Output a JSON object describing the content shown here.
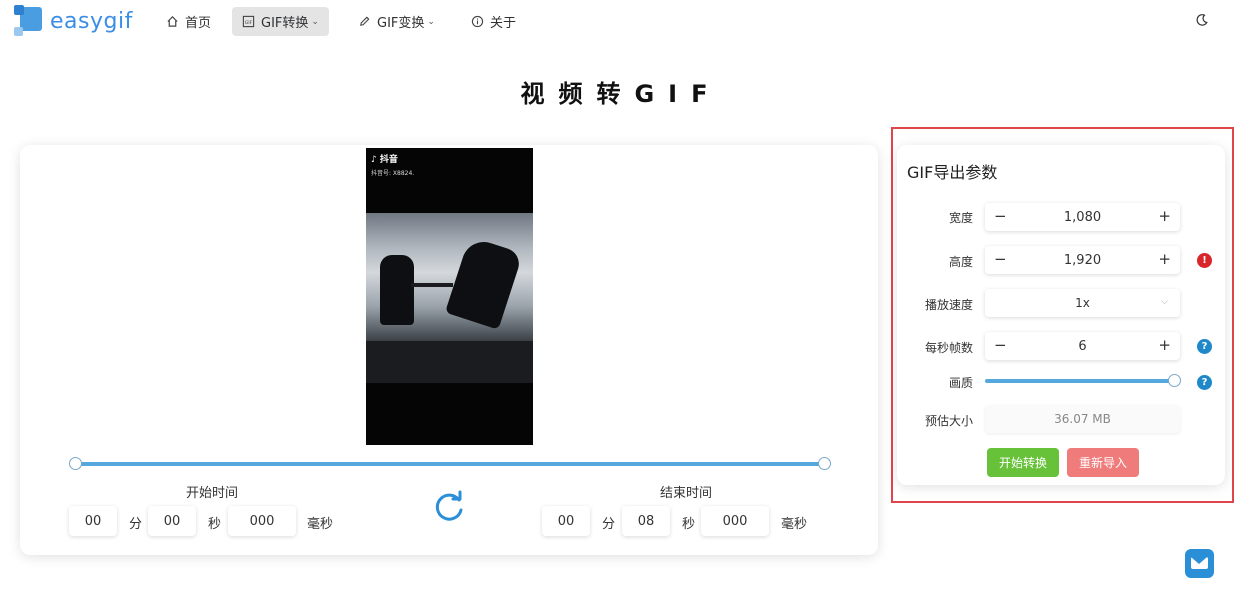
{
  "brand": {
    "name": "easygif"
  },
  "nav": {
    "items": [
      {
        "label": "首页",
        "icon": "home-icon"
      },
      {
        "label": "GIF转换",
        "icon": "gif-icon",
        "dropdown": true,
        "active": true
      },
      {
        "label": "GIF变换",
        "icon": "pencil-icon",
        "dropdown": true
      },
      {
        "label": "关于",
        "icon": "info-icon"
      }
    ],
    "theme_icon": "moon-icon"
  },
  "page": {
    "title": "视频转GIF"
  },
  "video": {
    "app_name": "抖音",
    "account_text": "抖音号: X8824."
  },
  "trim": {
    "start": {
      "label": "开始时间",
      "min": "00",
      "sec": "00",
      "ms": "000"
    },
    "end": {
      "label": "结束时间",
      "min": "00",
      "sec": "08",
      "ms": "000"
    },
    "units": {
      "min": "分",
      "sec": "秒",
      "ms": "毫秒"
    }
  },
  "export": {
    "title": "GIF导出参数",
    "width": {
      "label": "宽度",
      "value": "1,080"
    },
    "height": {
      "label": "高度",
      "value": "1,920"
    },
    "speed": {
      "label": "播放速度",
      "value": "1x"
    },
    "fps": {
      "label": "每秒帧数",
      "value": "6"
    },
    "quality": {
      "label": "画质",
      "level": 1.0
    },
    "estimate": {
      "label": "预估大小",
      "value": "36.07 MB"
    },
    "start_button": "开始转换",
    "reimport_button": "重新导入"
  },
  "glyphs": {
    "minus": "−",
    "plus": "+",
    "caret": "⌵",
    "chevron": "⌄",
    "error": "!",
    "help": "?"
  },
  "colors": {
    "accent": "#54a8de",
    "primary_blue": "#2a8fd6",
    "start_green": "#67c23a",
    "reimport_red": "#f07b7b",
    "highlight_frame": "#e0454b"
  }
}
